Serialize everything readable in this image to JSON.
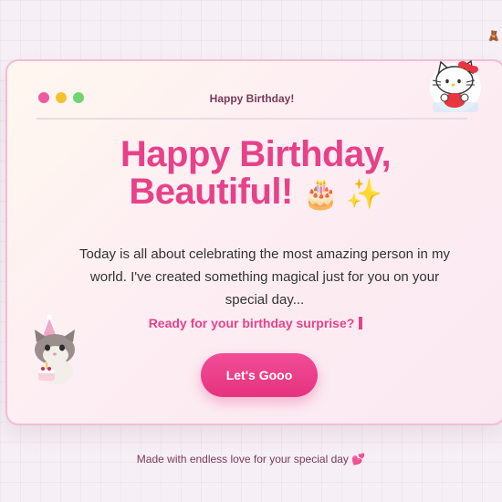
{
  "corner_emoji": "🧸",
  "window": {
    "title": "Happy Birthday!",
    "controls": {
      "close_color": "#f05a9e",
      "minimize_color": "#f5c12e",
      "maximize_color": "#6fd66f"
    }
  },
  "headline": {
    "line1": "Happy Birthday,",
    "line2": "Beautiful!",
    "emojis": "🎂 ✨"
  },
  "message": "Today is all about celebrating the most amazing person in my world. I've created something magical just for you on your special day...",
  "prompt": "Ready for your birthday surprise?",
  "cta_label": "Let's Gooo",
  "footer": "Made with endless love for your special day 💕",
  "stickers": {
    "top_right": "hello-kitty-sticker",
    "bottom_left": "kitten-with-cake-sticker"
  },
  "colors": {
    "accent": "#e8418a",
    "title_text": "#7a3a5a",
    "window_border": "#f2bcd4"
  }
}
